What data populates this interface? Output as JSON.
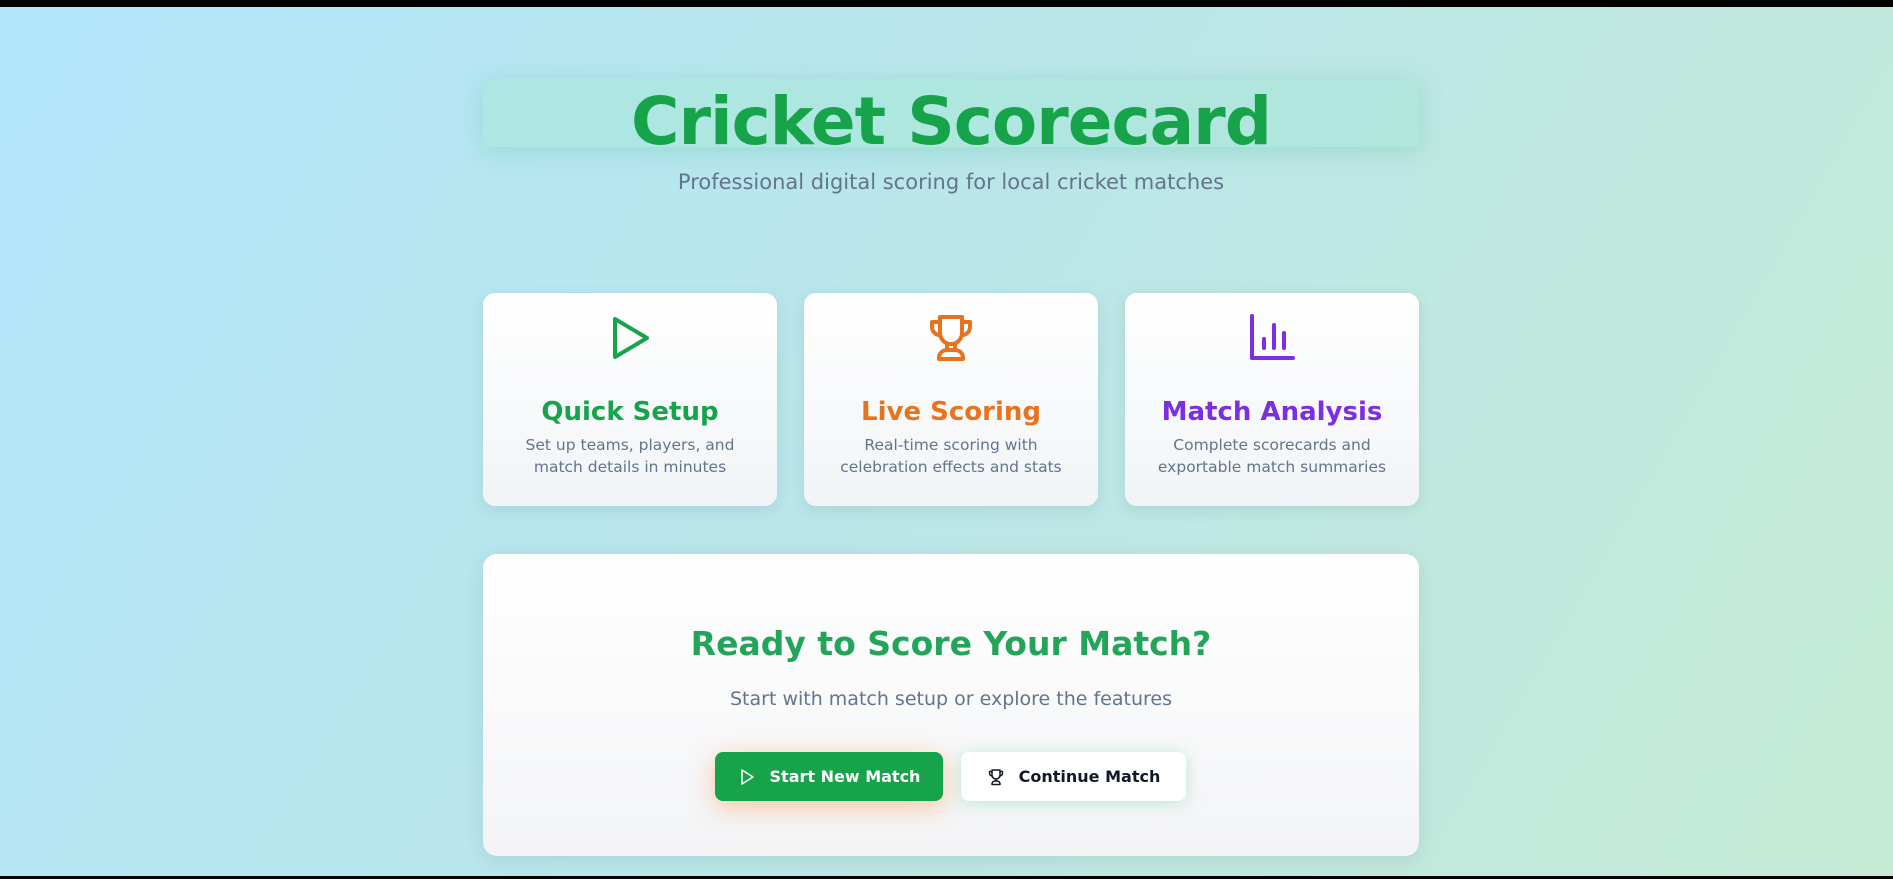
{
  "header": {
    "title": "Cricket Scorecard",
    "subtitle": "Professional digital scoring for local cricket matches"
  },
  "features": [
    {
      "icon": "play-icon",
      "title": "Quick Setup",
      "description": "Set up teams, players, and match details in minutes",
      "color": "#16a34a"
    },
    {
      "icon": "trophy-icon",
      "title": "Live Scoring",
      "description": "Real-time scoring with celebration effects and stats",
      "color": "#e8731f"
    },
    {
      "icon": "bar-chart-icon",
      "title": "Match Analysis",
      "description": "Complete scorecards and exportable match summaries",
      "color": "#7c2ee0"
    }
  ],
  "cta": {
    "title": "Ready to Score Your Match?",
    "subtitle": "Start with match setup or explore the features",
    "primary_button": "Start New Match",
    "secondary_button": "Continue Match"
  },
  "colors": {
    "brand_green": "#16a34a",
    "muted_text": "#64748b"
  }
}
